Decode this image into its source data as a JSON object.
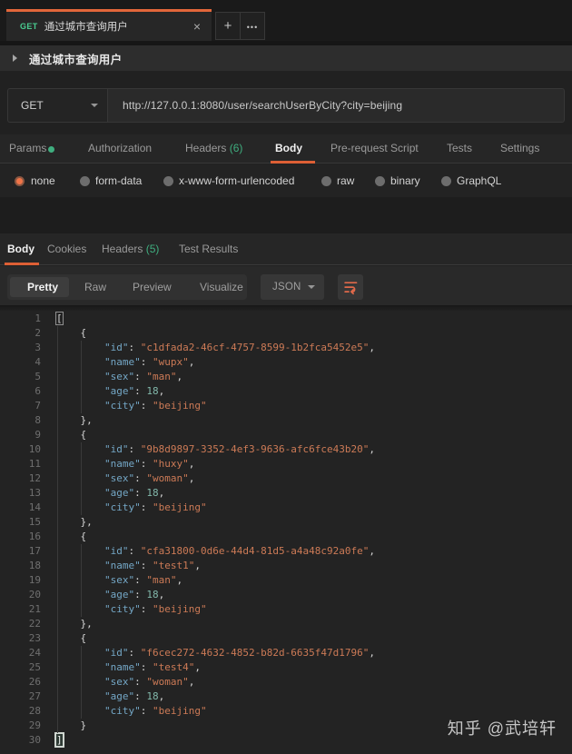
{
  "colors": {
    "accent_orange": "#e2663a",
    "get_green": "#49cc90",
    "count_green": "#3fae7f",
    "code_key": "#74a7c6",
    "code_string": "#cc7a56",
    "code_number": "#82b8ab"
  },
  "tabbar": {
    "active_tab": {
      "method": "GET",
      "title": "通过城市查询用户",
      "close": "×"
    },
    "new_tab_label": "+",
    "more_tabs_label": "•••"
  },
  "request": {
    "name": "通过城市查询用户",
    "method": "GET",
    "url": "http://127.0.0.1:8080/user/searchUserByCity?city=beijing",
    "tabs": [
      {
        "label": "Params"
      },
      {
        "label": "Authorization"
      },
      {
        "label": "Headers",
        "count": "(6)"
      },
      {
        "label": "Body",
        "active": true
      },
      {
        "label": "Pre-request Script"
      },
      {
        "label": "Tests"
      },
      {
        "label": "Settings"
      }
    ],
    "body_modes": [
      {
        "label": "none",
        "selected": true
      },
      {
        "label": "form-data"
      },
      {
        "label": "x-www-form-urlencoded"
      },
      {
        "label": "raw"
      },
      {
        "label": "binary"
      },
      {
        "label": "GraphQL"
      }
    ]
  },
  "response": {
    "tabs": [
      {
        "label": "Body",
        "active": true
      },
      {
        "label": "Cookies"
      },
      {
        "label": "Headers",
        "count": "(5)"
      },
      {
        "label": "Test Results"
      }
    ],
    "view_modes": [
      {
        "label": "Pretty",
        "active": true
      },
      {
        "label": "Raw"
      },
      {
        "label": "Preview"
      },
      {
        "label": "Visualize"
      }
    ],
    "format": "JSON",
    "body_json": [
      {
        "id": "c1dfada2-46cf-4757-8599-1b2fca5452e5",
        "name": "wupx",
        "sex": "man",
        "age": 18,
        "city": "beijing"
      },
      {
        "id": "9b8d9897-3352-4ef3-9636-afc6fce43b20",
        "name": "huxy",
        "sex": "woman",
        "age": 18,
        "city": "beijing"
      },
      {
        "id": "cfa31800-0d6e-44d4-81d5-a4a48c92a0fe",
        "name": "test1",
        "sex": "man",
        "age": 18,
        "city": "beijing"
      },
      {
        "id": "f6cec272-4632-4852-b82d-6635f47d1796",
        "name": "test4",
        "sex": "woman",
        "age": 18,
        "city": "beijing"
      }
    ]
  },
  "watermark": "知乎 @武培轩"
}
